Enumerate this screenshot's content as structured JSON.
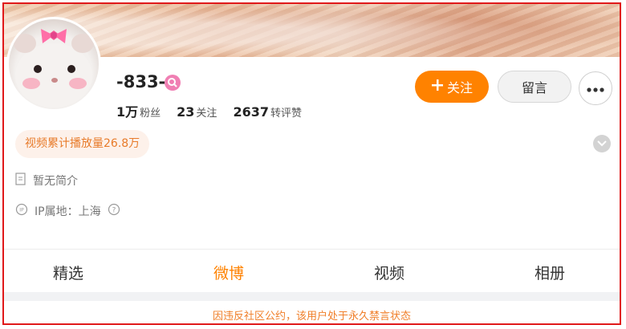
{
  "profile": {
    "username": "-833-",
    "stats": [
      {
        "number": "1万",
        "label": "粉丝"
      },
      {
        "number": "23",
        "label": "关注"
      },
      {
        "number": "2637",
        "label": "转评赞"
      }
    ],
    "actions": {
      "follow_label": "关注",
      "message_label": "留言"
    },
    "video_plays": "视频累计播放量26.8万",
    "bio": "暂无简介",
    "ip_location": "IP属地：上海"
  },
  "tabs": [
    {
      "label": "精选"
    },
    {
      "label": "微博"
    },
    {
      "label": "视频"
    },
    {
      "label": "相册"
    }
  ],
  "active_tab": "微博",
  "notice": "因违反社区公约，该用户处于永久禁言状态",
  "colors": {
    "accent": "#ff8200",
    "frame": "#e0191a",
    "pill_bg": "#fdf1ea",
    "pill_text": "#e87b2a",
    "notice_text": "#f07f2a",
    "verify": "#f07fb3"
  }
}
